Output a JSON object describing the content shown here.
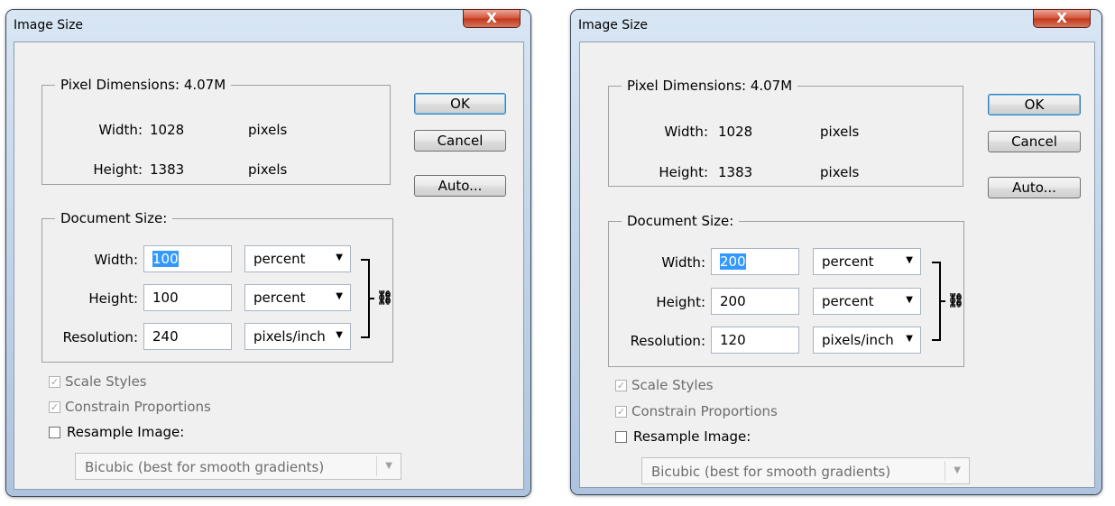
{
  "dialogs": [
    {
      "title": "Image Size",
      "close_icon": "X",
      "pixel_dimensions": {
        "legend": "Pixel Dimensions:  4.07M",
        "width_label": "Width:",
        "width_value": "1028",
        "width_unit": "pixels",
        "height_label": "Height:",
        "height_value": "1383",
        "height_unit": "pixels"
      },
      "buttons": {
        "ok": "OK",
        "cancel": "Cancel",
        "auto": "Auto..."
      },
      "document_size": {
        "legend": "Document Size:",
        "width_label": "Width:",
        "width_value": "100",
        "width_unit": "percent",
        "height_label": "Height:",
        "height_value": "100",
        "height_unit": "percent",
        "resolution_label": "Resolution:",
        "resolution_value": "240",
        "resolution_unit": "pixels/inch",
        "link_icon": "chain-link-icon"
      },
      "options": {
        "scale_styles": "Scale Styles",
        "scale_styles_checked": true,
        "constrain": "Constrain Proportions",
        "constrain_checked": true,
        "resample": "Resample Image:",
        "resample_checked": false,
        "interpolation": "Bicubic (best for smooth gradients)"
      }
    },
    {
      "title": "Image Size",
      "close_icon": "X",
      "pixel_dimensions": {
        "legend": "Pixel Dimensions:  4.07M",
        "width_label": "Width:",
        "width_value": "1028",
        "width_unit": "pixels",
        "height_label": "Height:",
        "height_value": "1383",
        "height_unit": "pixels"
      },
      "buttons": {
        "ok": "OK",
        "cancel": "Cancel",
        "auto": "Auto..."
      },
      "document_size": {
        "legend": "Document Size:",
        "width_label": "Width:",
        "width_value": "200",
        "width_unit": "percent",
        "height_label": "Height:",
        "height_value": "200",
        "height_unit": "percent",
        "resolution_label": "Resolution:",
        "resolution_value": "120",
        "resolution_unit": "pixels/inch",
        "link_icon": "chain-link-icon"
      },
      "options": {
        "scale_styles": "Scale Styles",
        "scale_styles_checked": true,
        "constrain": "Constrain Proportions",
        "constrain_checked": true,
        "resample": "Resample Image:",
        "resample_checked": false,
        "interpolation": "Bicubic (best for smooth gradients)"
      }
    }
  ],
  "colors": {
    "selection_highlight": "#3399ff",
    "close_button": "#c7432a",
    "dialog_face": "#f0f0f0",
    "default_button_border": "#3c7fb1"
  }
}
